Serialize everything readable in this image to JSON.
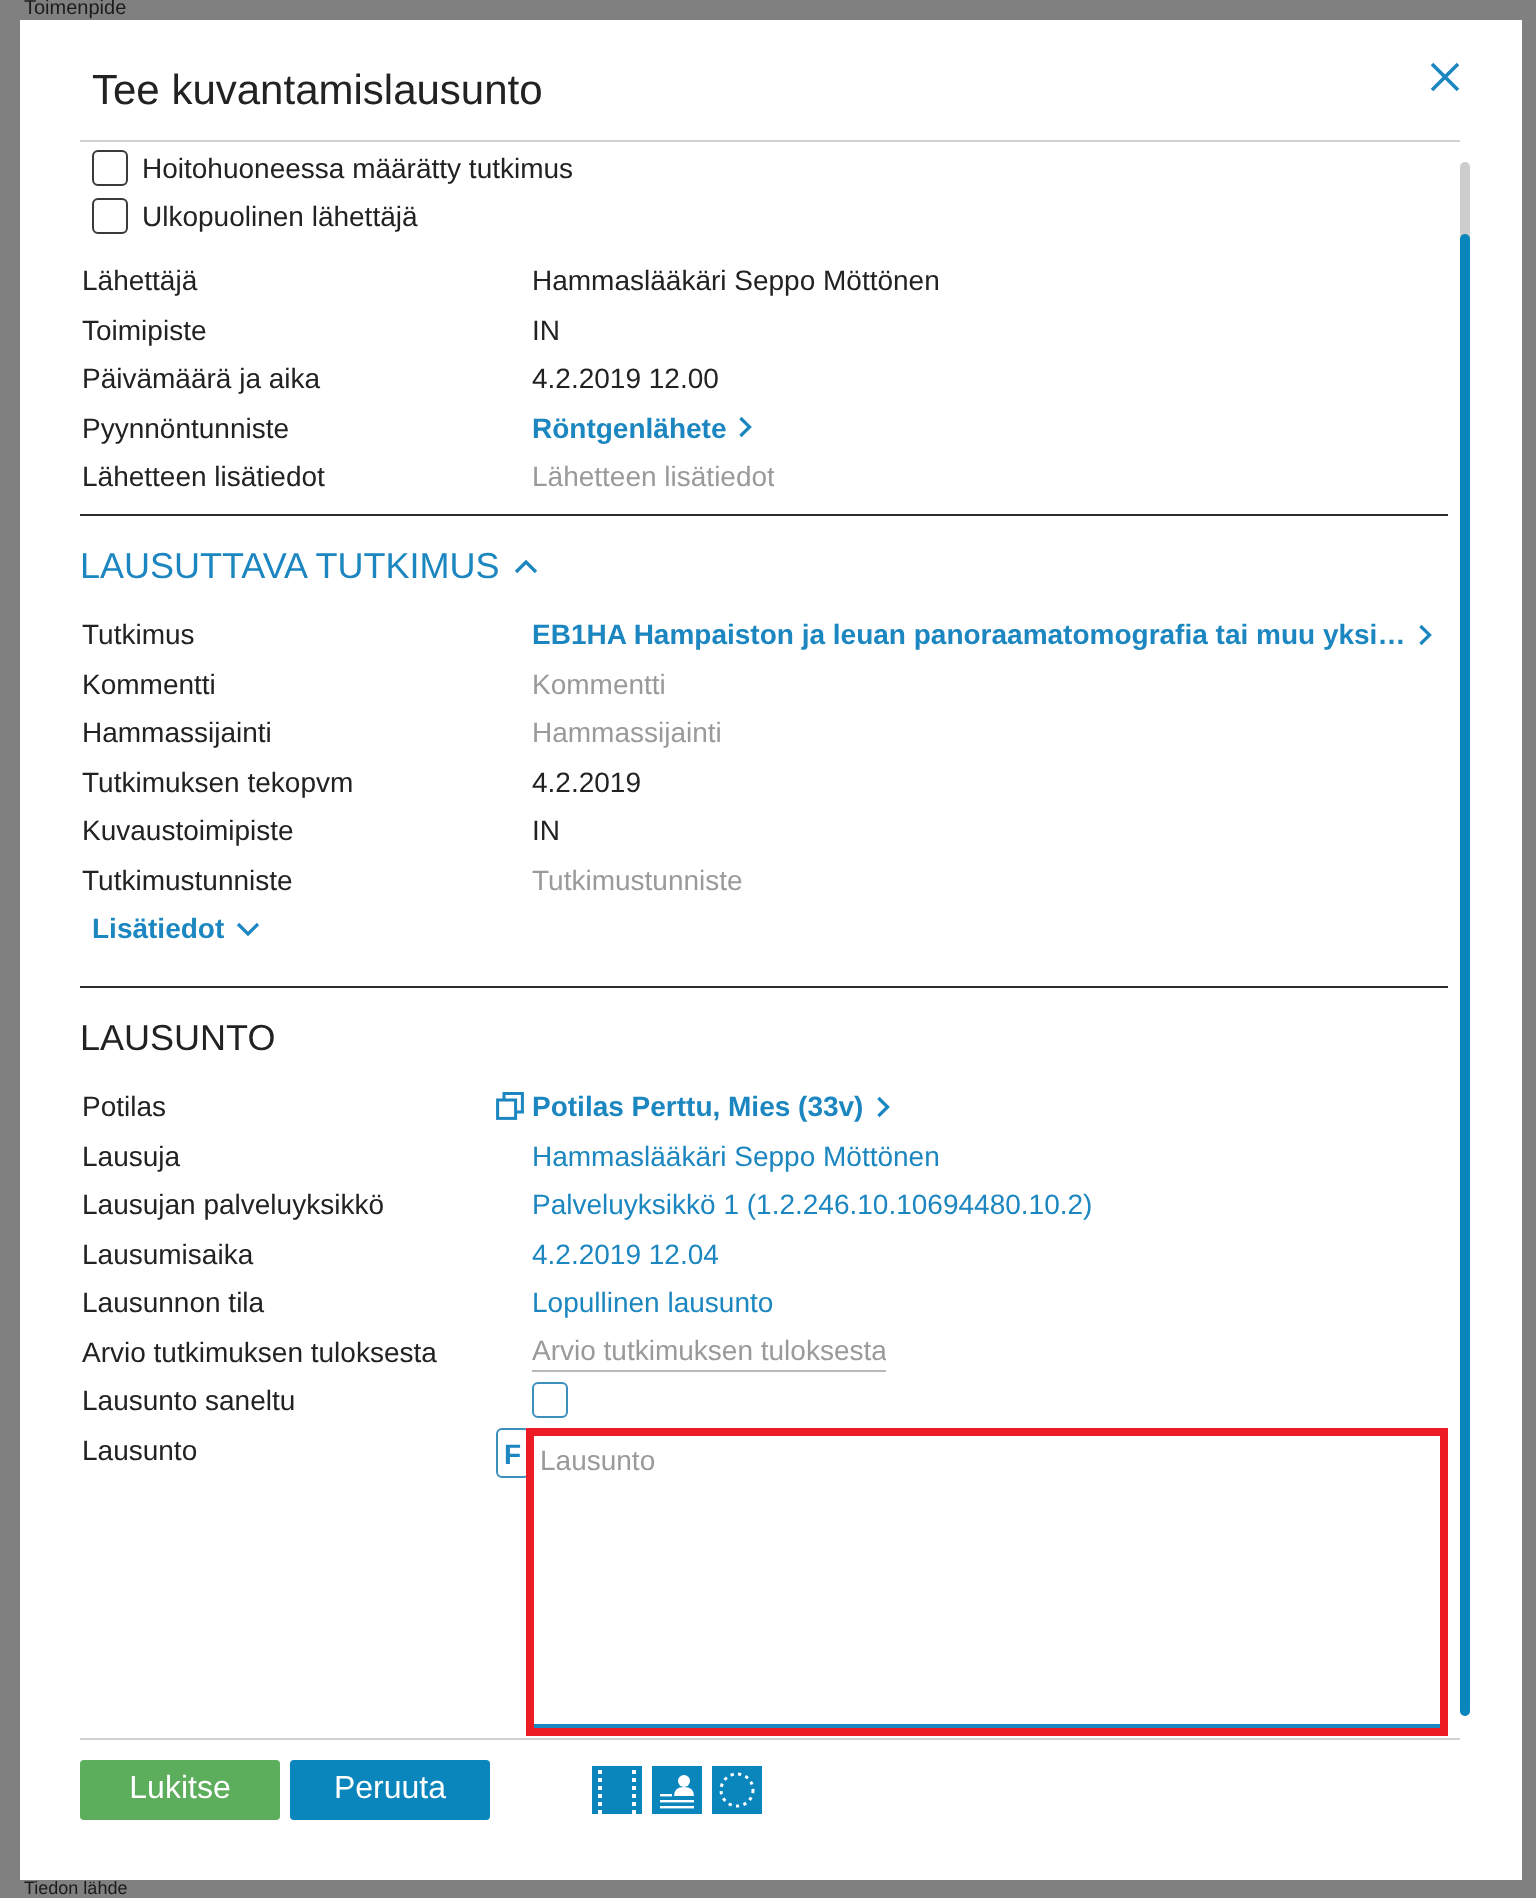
{
  "background": {
    "title": "Toimenpide",
    "footer_label": "Tiedon lähde"
  },
  "dialog": {
    "title": "Tee kuvantamislausunto"
  },
  "checkboxes": [
    {
      "label": "Hoitohuoneessa määrätty tutkimus",
      "checked": false
    },
    {
      "label": "Ulkopuolinen lähettäjä",
      "checked": false
    }
  ],
  "sender_fields": [
    {
      "label": "Lähettäjä",
      "kind": "text",
      "value": "Hammaslääkäri Seppo Möttönen"
    },
    {
      "label": "Toimipiste",
      "kind": "text",
      "value": "IN"
    },
    {
      "label": "Päivämäärä ja aika",
      "kind": "text",
      "value": "4.2.2019 12.00"
    },
    {
      "label": "Pyynnöntunniste",
      "kind": "link",
      "value": "Röntgenlähete"
    },
    {
      "label": "Lähetteen lisätiedot",
      "kind": "input",
      "placeholder": "Lähetteen lisätiedot"
    }
  ],
  "study_section": {
    "title": "LAUSUTTAVA TUTKIMUS",
    "expanded": true,
    "fields": [
      {
        "label": "Tutkimus",
        "kind": "link",
        "value": "EB1HA Hampaiston ja leuan panoraamatomografia tai muu yksi…"
      },
      {
        "label": "Kommentti",
        "kind": "input",
        "placeholder": "Kommentti"
      },
      {
        "label": "Hammassijainti",
        "kind": "input",
        "placeholder": "Hammassijainti"
      },
      {
        "label": "Tutkimuksen tekopvm",
        "kind": "text",
        "value": "4.2.2019"
      },
      {
        "label": "Kuvaustoimipiste",
        "kind": "text",
        "value": "IN"
      },
      {
        "label": "Tutkimustunniste",
        "kind": "input",
        "placeholder": "Tutkimustunniste"
      }
    ],
    "more_toggle": {
      "label": "Lisätiedot",
      "expanded": false
    }
  },
  "statement_section": {
    "title": "LAUSUNTO",
    "fields": [
      {
        "label": "Potilas",
        "kind": "patient",
        "value": "Potilas Perttu, Mies (33v)"
      },
      {
        "label": "Lausuja",
        "kind": "editable",
        "value": "Hammaslääkäri Seppo Möttönen"
      },
      {
        "label": "Lausujan palveluyksikkö",
        "kind": "editable",
        "value": "Palveluyksikkö 1 (1.2.246.10.10694480.10.2)"
      },
      {
        "label": "Lausumisaika",
        "kind": "editable",
        "value": "4.2.2019 12.04"
      },
      {
        "label": "Lausunnon tila",
        "kind": "editable",
        "value": "Lopullinen lausunto"
      },
      {
        "label": "Arvio tutkimuksen tuloksesta",
        "kind": "underlined_input",
        "placeholder": "Arvio tutkimuksen tuloksesta"
      },
      {
        "label": "Lausunto saneltu",
        "kind": "checkbox",
        "checked": false
      },
      {
        "label": "Lausunto",
        "kind": "textarea",
        "button": "F",
        "placeholder": "Lausunto"
      }
    ]
  },
  "buttons": [
    {
      "label": "Lukitse",
      "kind": "confirm"
    },
    {
      "label": "Peruuta",
      "kind": "cancel"
    }
  ]
}
